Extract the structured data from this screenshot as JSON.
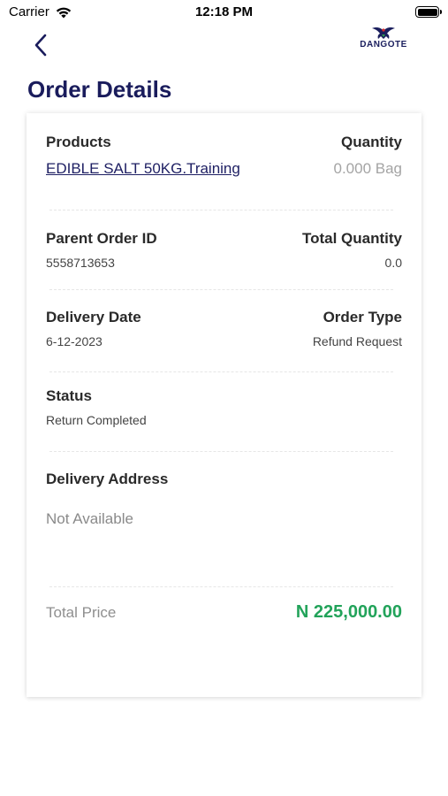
{
  "status_bar": {
    "carrier": "Carrier",
    "time": "12:18 PM"
  },
  "header": {
    "logo_text": "DANGOTE",
    "title": "Order Details"
  },
  "products": {
    "label": "Products",
    "quantity_label": "Quantity",
    "product_name": "EDIBLE SALT 50KG.Training",
    "quantity_value": "0.000 Bag"
  },
  "order": {
    "parent_label": "Parent Order ID",
    "parent_value": "5558713653",
    "total_qty_label": "Total Quantity",
    "total_qty_value": "0.0"
  },
  "delivery": {
    "date_label": "Delivery Date",
    "date_value": "6-12-2023",
    "type_label": "Order Type",
    "type_value": "Refund Request"
  },
  "status": {
    "label": "Status",
    "value": "Return Completed"
  },
  "address": {
    "label": "Delivery Address",
    "value": "Not Available"
  },
  "total": {
    "label": "Total Price",
    "value": "N 225,000.00"
  },
  "colors": {
    "brand_navy": "#1a1c5c",
    "price_green": "#22a35a"
  }
}
